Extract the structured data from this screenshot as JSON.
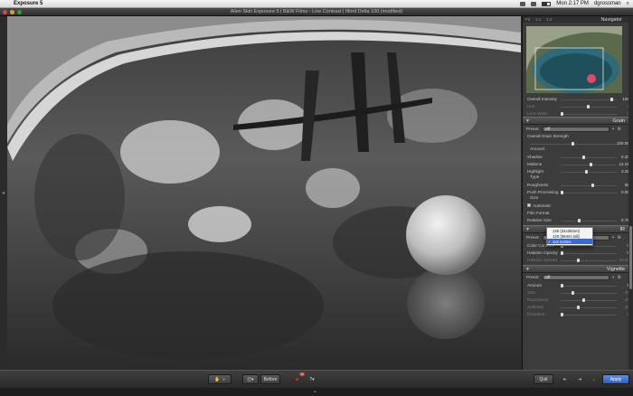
{
  "menubar": {
    "app_name": "Exposure 5",
    "time": "Mon 2:17 PM",
    "user": "dgrossman"
  },
  "window": {
    "title": "Alien Skin Exposure 5 | B&W Films - Low Contrast | Ilford Delta 100 (modified)"
  },
  "navigator": {
    "zoom_options": [
      "Fit",
      "1:1",
      "1:2"
    ],
    "title": "Navigator"
  },
  "top_rows": [
    {
      "label": "Overall Intensity",
      "value": "100",
      "pos": 0.93,
      "dim": false
    },
    {
      "label": "Hue",
      "value": "0",
      "pos": 0.5,
      "dim": true
    },
    {
      "label": "Lens Wash",
      "value": "0",
      "pos": 0.0,
      "dim": true
    }
  ],
  "grain": {
    "title": "Grain",
    "preset_label": "Preset:",
    "preset_value": "Off",
    "overall_label": "Overall Grain Strength",
    "overall_value": "100.00",
    "amount_heading": "Amount",
    "amount_rows": [
      {
        "label": "Shadow",
        "value": "0.20",
        "pos": 0.4
      },
      {
        "label": "Midtone",
        "value": "14.21",
        "pos": 0.55
      },
      {
        "label": "Highlight",
        "value": "3.28",
        "pos": 0.45
      }
    ],
    "type_heading": "Type",
    "type_rows": [
      {
        "label": "Roughness",
        "value": "58",
        "pos": 0.58
      },
      {
        "label": "Push Processing",
        "value": "0.00",
        "pos": 0.0
      }
    ],
    "size_heading": "Size",
    "automatic_label": "Automatic",
    "film_format_label": "Film Format",
    "relative_size_label": "Relative Size",
    "relative_size_value": "0.79"
  },
  "film_format_options": [
    {
      "label": "135 (24x36mm)",
      "selected": false
    },
    {
      "label": "120 (56mm tall)",
      "selected": false
    },
    {
      "label": "4x5 inches",
      "selected": true
    }
  ],
  "ir": {
    "title": "IR",
    "preset_label": "Preset:",
    "preset_value": "Off",
    "rows": [
      {
        "label": "Color Contrast",
        "value": "0",
        "pos": 0.0,
        "dim": false
      },
      {
        "label": "Halation Opacity",
        "value": "0",
        "pos": 0.0,
        "dim": false
      },
      {
        "label": "Halation Spread",
        "value": "20.00",
        "pos": 0.3,
        "dim": true
      }
    ]
  },
  "vignette": {
    "title": "Vignette",
    "preset_label": "Preset:",
    "preset_value": "Off",
    "rows": [
      {
        "label": "Amount",
        "value": "0",
        "pos": 0.0,
        "dim": false
      },
      {
        "label": "Size",
        "value": "20",
        "pos": 0.2,
        "dim": true
      },
      {
        "label": "Roundness",
        "value": "40",
        "pos": 0.4,
        "dim": true
      },
      {
        "label": "Softness",
        "value": "30",
        "pos": 0.3,
        "dim": true
      },
      {
        "label": "Distortion",
        "value": "0",
        "pos": 0.0,
        "dim": true
      }
    ]
  },
  "bottombar": {
    "before_label": "Before",
    "quit_label": "Quit",
    "apply_label": "Apply",
    "badge_count": "10"
  },
  "icons": {
    "hand": "hand-tool-icon",
    "zoom": "zoom-tool-icon",
    "split": "split-view-icon",
    "gift": "gift-icon",
    "help": "help-icon",
    "undo": "undo-icon",
    "redo": "redo-icon"
  },
  "colors": {
    "accent_blue": "#2c5fc6",
    "panel_bg": "#3c3c3c"
  }
}
